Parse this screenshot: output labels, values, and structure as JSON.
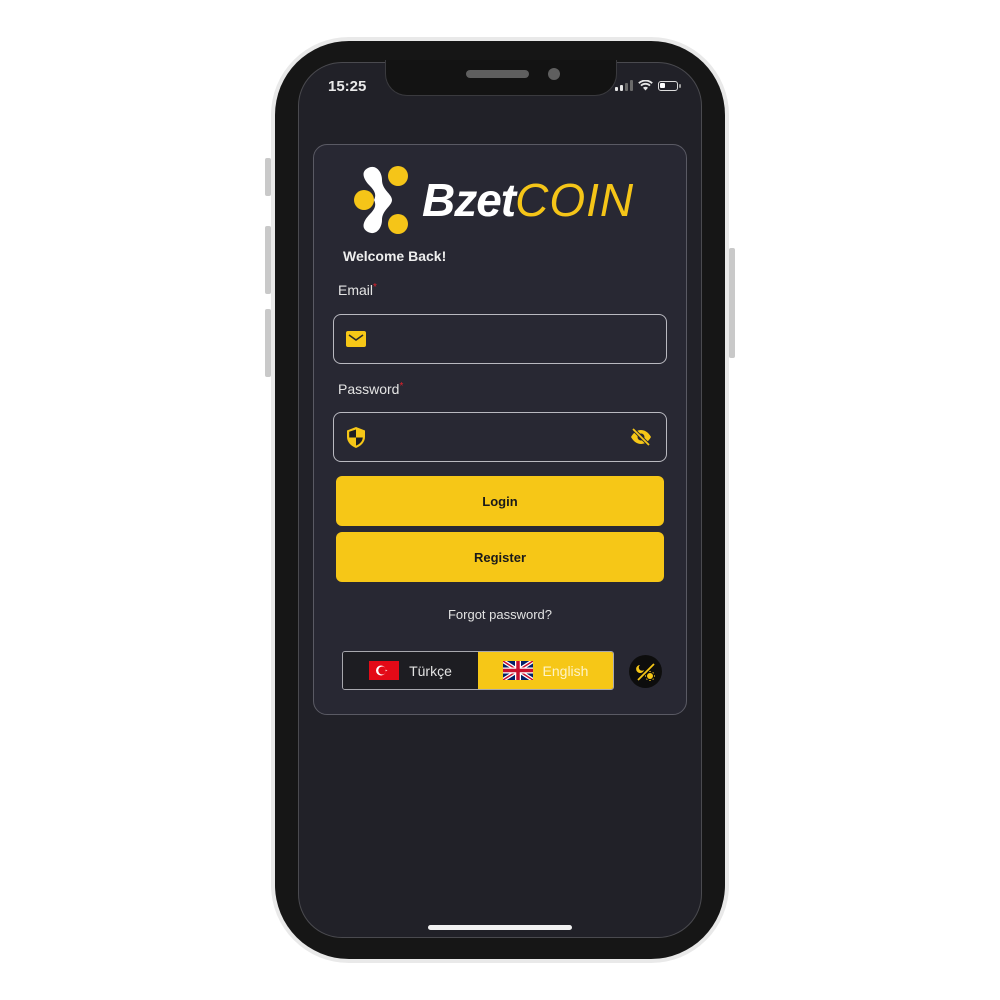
{
  "status_bar": {
    "time": "15:25",
    "battery_level": 0.35,
    "signal_bars_active": 2,
    "signal_bars_total": 4
  },
  "brand": {
    "name_part1": "Bzet",
    "name_part2": "COIN",
    "accent_color": "#f6c717"
  },
  "login": {
    "welcome": "Welcome Back!",
    "email_label": "Email",
    "email_required_mark": "*",
    "email_value": "",
    "email_icon": "envelope-icon",
    "password_label": "Password",
    "password_required_mark": "*",
    "password_value": "",
    "password_icon": "shield-icon",
    "password_toggle_icon": "eye-off-icon",
    "login_button": "Login",
    "register_button": "Register",
    "forgot_password": "Forgot password?"
  },
  "language": {
    "options": [
      {
        "label": "Türkçe",
        "flag": "turkey-flag",
        "selected": false
      },
      {
        "label": "English",
        "flag": "uk-flag",
        "selected": true
      }
    ],
    "theme_toggle_icon": "theme-toggle-icon"
  }
}
